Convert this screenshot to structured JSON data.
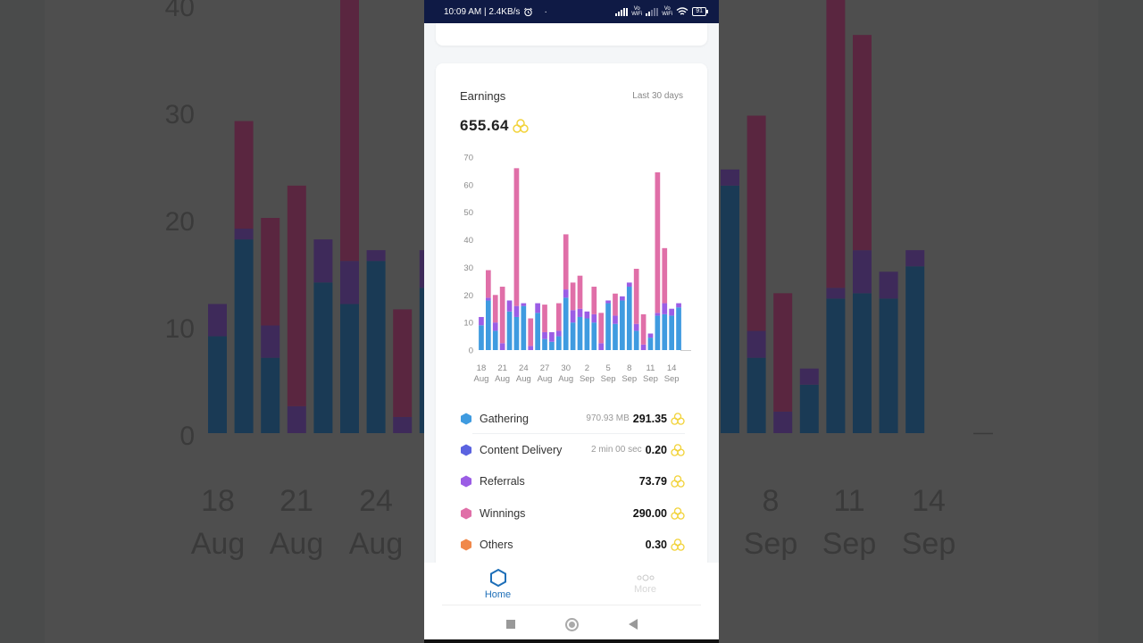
{
  "status_bar": {
    "time_speed": "10:09 AM | 2.4KB/s",
    "alarm_icon": "alarm-clock-icon",
    "dot": "·",
    "vo_wifi_1": "Vo WiFi",
    "vo_wifi_2": "Vo WiFi",
    "battery": "91"
  },
  "earnings": {
    "title": "Earnings",
    "range": "Last 30 days",
    "total": "655.64",
    "coin_icon": "honeycomb-coin-icon"
  },
  "colors": {
    "gathering": "#3f9be0",
    "content_delivery": "#5b63e0",
    "referrals": "#9b5de5",
    "winnings": "#e06fa8",
    "others": "#f0884a",
    "coin": "#f2d33a",
    "accent": "#1e6fb8",
    "status_bar": "#0f1a45"
  },
  "chart_data": {
    "type": "bar",
    "stacked": true,
    "title": "Earnings",
    "xlabel": "",
    "ylabel": "",
    "ylim": [
      0,
      70
    ],
    "yticks": [
      0,
      10,
      20,
      30,
      40,
      50,
      60,
      70
    ],
    "grid": false,
    "categories": [
      "18 Aug",
      "19 Aug",
      "20 Aug",
      "21 Aug",
      "22 Aug",
      "23 Aug",
      "24 Aug",
      "25 Aug",
      "26 Aug",
      "27 Aug",
      "28 Aug",
      "29 Aug",
      "30 Aug",
      "31 Aug",
      "1 Sep",
      "2 Sep",
      "3 Sep",
      "4 Sep",
      "5 Sep",
      "6 Sep",
      "7 Sep",
      "8 Sep",
      "9 Sep",
      "10 Sep",
      "11 Sep",
      "12 Sep",
      "13 Sep",
      "14 Sep",
      "15 Sep"
    ],
    "xtick_labels": [
      {
        "index": 0,
        "line1": "18",
        "line2": "Aug"
      },
      {
        "index": 3,
        "line1": "21",
        "line2": "Aug"
      },
      {
        "index": 6,
        "line1": "24",
        "line2": "Aug"
      },
      {
        "index": 9,
        "line1": "27",
        "line2": "Aug"
      },
      {
        "index": 12,
        "line1": "30",
        "line2": "Aug"
      },
      {
        "index": 15,
        "line1": "2",
        "line2": "Sep"
      },
      {
        "index": 18,
        "line1": "5",
        "line2": "Sep"
      },
      {
        "index": 21,
        "line1": "8",
        "line2": "Sep"
      },
      {
        "index": 24,
        "line1": "11",
        "line2": "Sep"
      },
      {
        "index": 27,
        "line1": "14",
        "line2": "Sep"
      }
    ],
    "series": [
      {
        "name": "Gathering",
        "color": "#3f9be0",
        "values": [
          9,
          18,
          7,
          0,
          14,
          12,
          16,
          0,
          13.5,
          4,
          3,
          5,
          19,
          10,
          12,
          11.5,
          10,
          0,
          17,
          9.5,
          18,
          23,
          7,
          0,
          4.5,
          12.5,
          13,
          12.5,
          15.5
        ]
      },
      {
        "name": "Referrals",
        "color": "#9b5de5",
        "values": [
          3,
          1,
          3,
          2.5,
          4,
          4,
          1,
          1.5,
          3.5,
          2.5,
          3.5,
          2,
          3,
          4.5,
          3,
          2.5,
          3,
          2.5,
          1,
          3,
          1.5,
          1.5,
          2.5,
          2,
          1.5,
          1,
          4,
          2.5,
          1.5
        ]
      },
      {
        "name": "Winnings",
        "color": "#e06fa8",
        "values": [
          0,
          10,
          10,
          20.5,
          0,
          50,
          0,
          10,
          0,
          10,
          0,
          10,
          20,
          10,
          12,
          0,
          10,
          11,
          0,
          8,
          0,
          0,
          20,
          11,
          0,
          51,
          20,
          0,
          0
        ]
      }
    ]
  },
  "legend": [
    {
      "name": "Gathering",
      "sub": "970.93 MB",
      "value": "291.35",
      "color_key": "gathering"
    },
    {
      "name": "Content Delivery",
      "sub": "2 min 00 sec",
      "value": "0.20",
      "color_key": "content_delivery"
    },
    {
      "name": "Referrals",
      "sub": "",
      "value": "73.79",
      "color_key": "referrals"
    },
    {
      "name": "Winnings",
      "sub": "",
      "value": "290.00",
      "color_key": "winnings"
    },
    {
      "name": "Others",
      "sub": "",
      "value": "0.30",
      "color_key": "others"
    }
  ],
  "bottom_nav": {
    "home_label": "Home",
    "home_icon": "hexagon-icon",
    "more_label": "More",
    "more_icon": "more-dots-icon"
  },
  "system_nav": {
    "recents_icon": "square-icon",
    "home_icon": "circle-icon",
    "back_icon": "triangle-back-icon"
  },
  "background": {
    "yticks": [
      "40",
      "30",
      "20",
      "10",
      "0"
    ],
    "left_labels": [
      {
        "d": "18",
        "m": "Aug"
      },
      {
        "d": "21",
        "m": "Aug"
      },
      {
        "d": "24",
        "m": "Aug"
      }
    ],
    "right_labels": [
      {
        "d": "8",
        "m": "Sep"
      },
      {
        "d": "11",
        "m": "Sep"
      },
      {
        "d": "14",
        "m": "Sep"
      }
    ]
  }
}
